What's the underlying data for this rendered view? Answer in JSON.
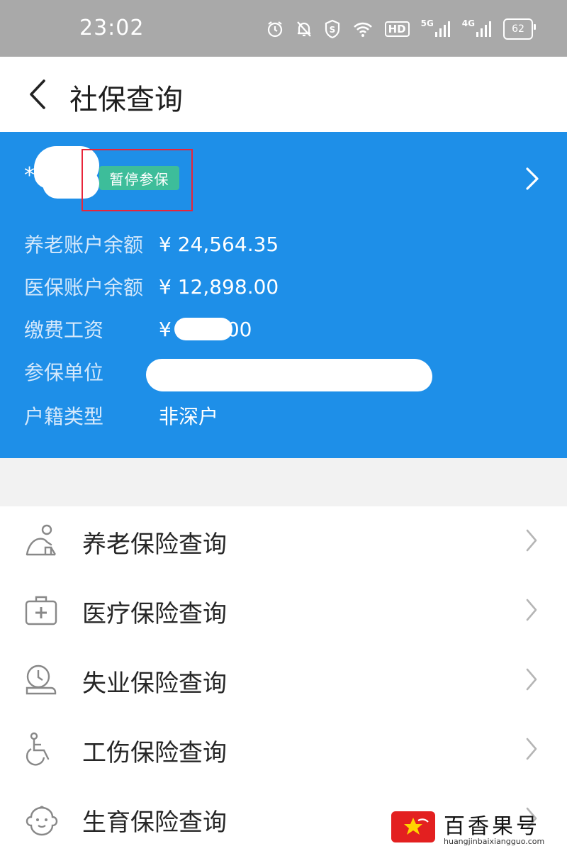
{
  "status_bar": {
    "time": "23:02",
    "hd_label": "HD",
    "signal1_label": "5G",
    "signal2_label": "4G",
    "battery": "62"
  },
  "nav": {
    "title": "社保查询",
    "back_icon": "chevron-left-icon"
  },
  "card": {
    "name_masked": "*",
    "status_badge": "暂停参保",
    "rows": [
      {
        "label": "养老账户余额",
        "value": "¥ 24,564.35"
      },
      {
        "label": "医保账户余额",
        "value": "¥ 12,898.00"
      },
      {
        "label": "缴费工资",
        "value_prefix": "¥",
        "value_suffix": "00"
      },
      {
        "label": "参保单位"
      },
      {
        "label": "户籍类型",
        "value": "非深户"
      }
    ],
    "colors": {
      "background": "#1e8fe8",
      "badge": "#3dbd9a",
      "highlight": "#e8253a"
    }
  },
  "menu": {
    "items": [
      {
        "label": "养老保险查询",
        "icon": "elderly-person-icon"
      },
      {
        "label": "医疗保险查询",
        "icon": "medical-kit-icon"
      },
      {
        "label": "失业保险查询",
        "icon": "clock-desk-icon"
      },
      {
        "label": "工伤保险查询",
        "icon": "wheelchair-icon"
      },
      {
        "label": "生育保险查询",
        "icon": "baby-face-icon"
      }
    ]
  },
  "watermark": {
    "text": "百香果号",
    "url": "huangjinbaixiangguo.com"
  }
}
